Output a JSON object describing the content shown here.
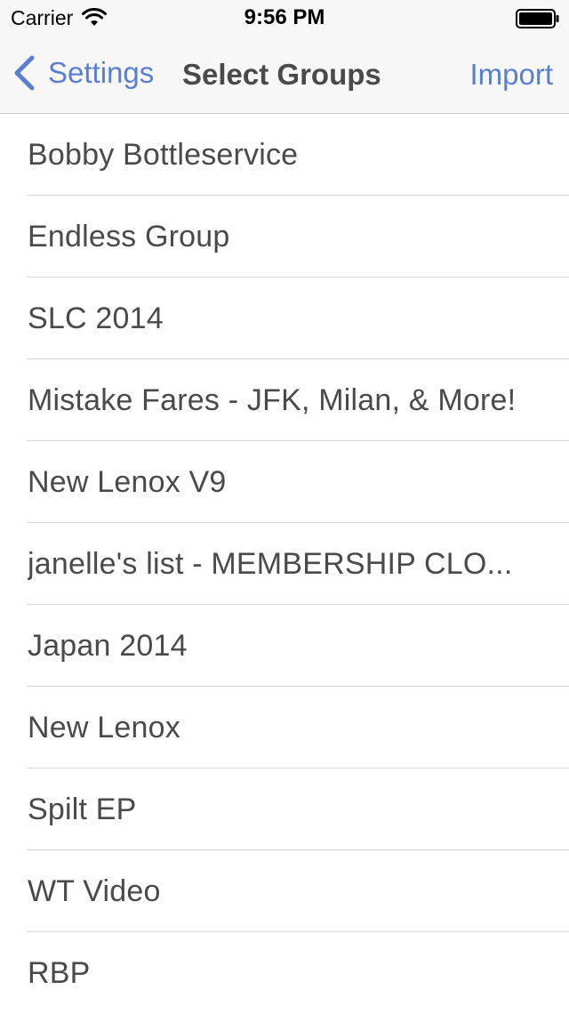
{
  "status_bar": {
    "carrier": "Carrier",
    "time": "9:56 PM",
    "wifi_icon": "wifi-icon",
    "battery_icon": "battery-icon"
  },
  "nav": {
    "back_label": "Settings",
    "back_icon": "chevron-left-icon",
    "title": "Select Groups",
    "action_label": "Import",
    "accent_color": "#5b7fd0"
  },
  "groups": [
    "Bobby Bottleservice",
    "Endless Group",
    "SLC 2014",
    "Mistake Fares - JFK, Milan, & More!",
    "New Lenox V9",
    "janelle's list - MEMBERSHIP CLO...",
    "Japan 2014",
    "New Lenox",
    "Spilt EP",
    "WT Video",
    "RBP"
  ]
}
